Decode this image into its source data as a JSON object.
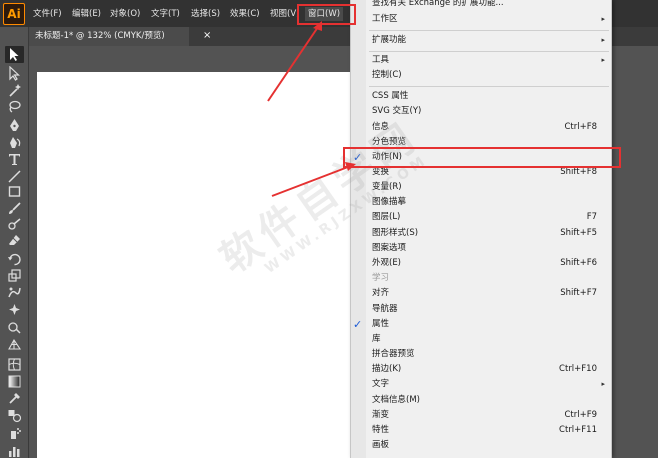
{
  "app": {
    "logo": "Ai"
  },
  "menubar": {
    "items": [
      {
        "label": "文件(F)"
      },
      {
        "label": "编辑(E)"
      },
      {
        "label": "对象(O)"
      },
      {
        "label": "文字(T)"
      },
      {
        "label": "选择(S)"
      },
      {
        "label": "效果(C)"
      },
      {
        "label": "视图(V)"
      },
      {
        "label": "窗口(W)"
      }
    ]
  },
  "document": {
    "tab_title": "未标题-1* @ 132% (CMYK/预览)",
    "close_symbol": "×"
  },
  "window_menu": {
    "items": [
      {
        "label": "查找有关 Exchange 的扩展功能...",
        "shortcut": "",
        "submenu": false,
        "checked": false,
        "disabled": false
      },
      {
        "label": "工作区",
        "shortcut": "",
        "submenu": true,
        "checked": false,
        "disabled": false
      },
      {
        "label": "扩展功能",
        "shortcut": "",
        "submenu": true,
        "checked": false,
        "disabled": false
      },
      {
        "label": "工具",
        "shortcut": "",
        "submenu": true,
        "checked": false,
        "disabled": false
      },
      {
        "label": "控制(C)",
        "shortcut": "",
        "submenu": false,
        "checked": false,
        "disabled": false
      },
      {
        "label": "CSS 属性",
        "shortcut": "",
        "submenu": false,
        "checked": false,
        "disabled": false
      },
      {
        "label": "SVG 交互(Y)",
        "shortcut": "",
        "submenu": false,
        "checked": false,
        "disabled": false
      },
      {
        "label": "信息",
        "shortcut": "Ctrl+F8",
        "submenu": false,
        "checked": false,
        "disabled": false
      },
      {
        "label": "分色预览",
        "shortcut": "",
        "submenu": false,
        "checked": false,
        "disabled": false
      },
      {
        "label": "动作(N)",
        "shortcut": "",
        "submenu": false,
        "checked": true,
        "disabled": false
      },
      {
        "label": "变换",
        "shortcut": "Shift+F8",
        "submenu": false,
        "checked": false,
        "disabled": false
      },
      {
        "label": "变量(R)",
        "shortcut": "",
        "submenu": false,
        "checked": false,
        "disabled": false
      },
      {
        "label": "图像描摹",
        "shortcut": "",
        "submenu": false,
        "checked": false,
        "disabled": false
      },
      {
        "label": "图层(L)",
        "shortcut": "F7",
        "submenu": false,
        "checked": false,
        "disabled": false
      },
      {
        "label": "图形样式(S)",
        "shortcut": "Shift+F5",
        "submenu": false,
        "checked": false,
        "disabled": false
      },
      {
        "label": "图案选项",
        "shortcut": "",
        "submenu": false,
        "checked": false,
        "disabled": false
      },
      {
        "label": "外观(E)",
        "shortcut": "Shift+F6",
        "submenu": false,
        "checked": false,
        "disabled": false
      },
      {
        "label": "学习",
        "shortcut": "",
        "submenu": false,
        "checked": false,
        "disabled": true
      },
      {
        "label": "对齐",
        "shortcut": "Shift+F7",
        "submenu": false,
        "checked": false,
        "disabled": false
      },
      {
        "label": "导航器",
        "shortcut": "",
        "submenu": false,
        "checked": false,
        "disabled": false
      },
      {
        "label": "属性",
        "shortcut": "",
        "submenu": false,
        "checked": true,
        "disabled": false
      },
      {
        "label": "库",
        "shortcut": "",
        "submenu": false,
        "checked": false,
        "disabled": false
      },
      {
        "label": "拼合器预览",
        "shortcut": "",
        "submenu": false,
        "checked": false,
        "disabled": false
      },
      {
        "label": "描边(K)",
        "shortcut": "Ctrl+F10",
        "submenu": false,
        "checked": false,
        "disabled": false
      },
      {
        "label": "文字",
        "shortcut": "",
        "submenu": true,
        "checked": false,
        "disabled": false
      },
      {
        "label": "文档信息(M)",
        "shortcut": "",
        "submenu": false,
        "checked": false,
        "disabled": false
      },
      {
        "label": "渐变",
        "shortcut": "Ctrl+F9",
        "submenu": false,
        "checked": false,
        "disabled": false
      },
      {
        "label": "特性",
        "shortcut": "Ctrl+F11",
        "submenu": false,
        "checked": false,
        "disabled": false
      },
      {
        "label": "画板",
        "shortcut": "",
        "submenu": false,
        "checked": false,
        "disabled": false
      }
    ],
    "check_symbol": "✓",
    "submenu_symbol": "▸"
  },
  "watermark": {
    "main": "软件自学网",
    "sub": "WWW.RJZXW.COM"
  },
  "colors": {
    "annotation_red": "#e53131",
    "check_blue": "#1c5bd6",
    "logo_orange": "#ff9a00"
  }
}
